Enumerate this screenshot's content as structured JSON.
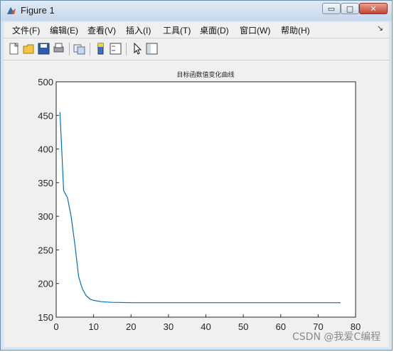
{
  "window": {
    "title": "Figure 1",
    "icons": {
      "app": "matlab-icon",
      "minimize": "minimize-icon",
      "maximize": "maximize-icon",
      "close": "close-icon"
    },
    "buttons": {
      "min": "▭",
      "max": "□",
      "close": "✕"
    }
  },
  "menu": {
    "items": [
      "文件(F)",
      "编辑(E)",
      "查看(V)",
      "插入(I)",
      "工具(T)",
      "桌面(D)",
      "窗口(W)",
      "帮助(H)"
    ],
    "overflow": "↘"
  },
  "toolbar": {
    "icons": [
      "new-figure-icon",
      "open-file-icon",
      "save-icon",
      "print-icon",
      "link-icon",
      "colorbar-icon",
      "legend-icon",
      "pointer-icon",
      "property-editor-icon"
    ]
  },
  "chart_data": {
    "type": "line",
    "title": "目标函数值变化曲线",
    "xlabel": "",
    "ylabel": "",
    "xlim": [
      0,
      80
    ],
    "ylim": [
      150,
      500
    ],
    "xticks": [
      0,
      10,
      20,
      30,
      40,
      50,
      60,
      70,
      80
    ],
    "yticks": [
      150,
      200,
      250,
      300,
      350,
      400,
      450,
      500
    ],
    "grid": false,
    "series": [
      {
        "color": "#0072bd",
        "x": [
          1,
          2,
          3,
          4,
          5,
          6,
          7,
          8,
          9,
          10,
          12,
          15,
          20,
          30,
          40,
          50,
          60,
          70,
          76
        ],
        "y": [
          455,
          338,
          328,
          300,
          258,
          210,
          192,
          182,
          177,
          175,
          173,
          172,
          171.5,
          171.5,
          171.5,
          171.5,
          171.5,
          171.5,
          171.5
        ]
      }
    ]
  },
  "watermark": "CSDN @我爱C编程"
}
